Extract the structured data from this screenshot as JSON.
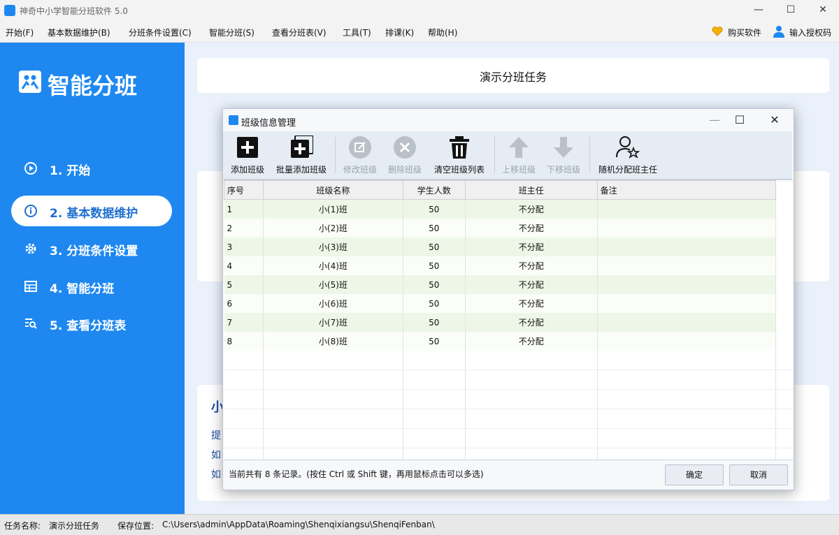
{
  "app": {
    "title": "神奇中小学智能分班软件 5.0"
  },
  "menu": {
    "items": [
      "开始(F)",
      "基本数据维护(B)",
      "分班条件设置(C)",
      "智能分班(S)",
      "查看分班表(V)",
      "工具(T)",
      "排课(K)",
      "帮助(H)"
    ],
    "buy": "购买软件",
    "auth": "输入授权码"
  },
  "sidebar": {
    "logo_text": "智能分班",
    "items": [
      {
        "label": "1. 开始",
        "icon": "play-circle-icon",
        "active": false
      },
      {
        "label": "2. 基本数据维护",
        "icon": "info-circle-icon",
        "active": true
      },
      {
        "label": "3. 分班条件设置",
        "icon": "gear-icon",
        "active": false
      },
      {
        "label": "4. 智能分班",
        "icon": "grid-icon",
        "active": false
      },
      {
        "label": "5. 查看分班表",
        "icon": "search-list-icon",
        "active": false
      }
    ]
  },
  "main": {
    "task_title": "演示分班任务",
    "panel3_chars": [
      "小",
      "提",
      "如",
      "如"
    ]
  },
  "dialog": {
    "title": "班级信息管理",
    "toolbar": {
      "add": "添加班级",
      "batch_add": "批量添加班级",
      "edit": "修改班级",
      "delete": "删除班级",
      "clear": "清空班级列表",
      "move_up": "上移班级",
      "move_down": "下移班级",
      "random_assign": "随机分配班主任"
    },
    "table": {
      "headers": [
        "序号",
        "班级名称",
        "学生人数",
        "班主任",
        "备注"
      ],
      "rows": [
        [
          "1",
          "小(1)班",
          "50",
          "不分配",
          ""
        ],
        [
          "2",
          "小(2)班",
          "50",
          "不分配",
          ""
        ],
        [
          "3",
          "小(3)班",
          "50",
          "不分配",
          ""
        ],
        [
          "4",
          "小(4)班",
          "50",
          "不分配",
          ""
        ],
        [
          "5",
          "小(5)班",
          "50",
          "不分配",
          ""
        ],
        [
          "6",
          "小(6)班",
          "50",
          "不分配",
          ""
        ],
        [
          "7",
          "小(7)班",
          "50",
          "不分配",
          ""
        ],
        [
          "8",
          "小(8)班",
          "50",
          "不分配",
          ""
        ]
      ]
    },
    "status": "当前共有 8 条记录。(按住 Ctrl 或 Shift 键，再用鼠标点击可以多选)",
    "ok": "确定",
    "cancel": "取消"
  },
  "statusbar": {
    "task_label": "任务名称:",
    "task_value": "演示分班任务",
    "save_label": "保存位置:",
    "save_value": "C:\\Users\\admin\\AppData\\Roaming\\Shenqixiangsu\\ShenqiFenban\\"
  },
  "colors": {
    "accent": "#1e88f0",
    "row_alt": "#eef7e7"
  }
}
